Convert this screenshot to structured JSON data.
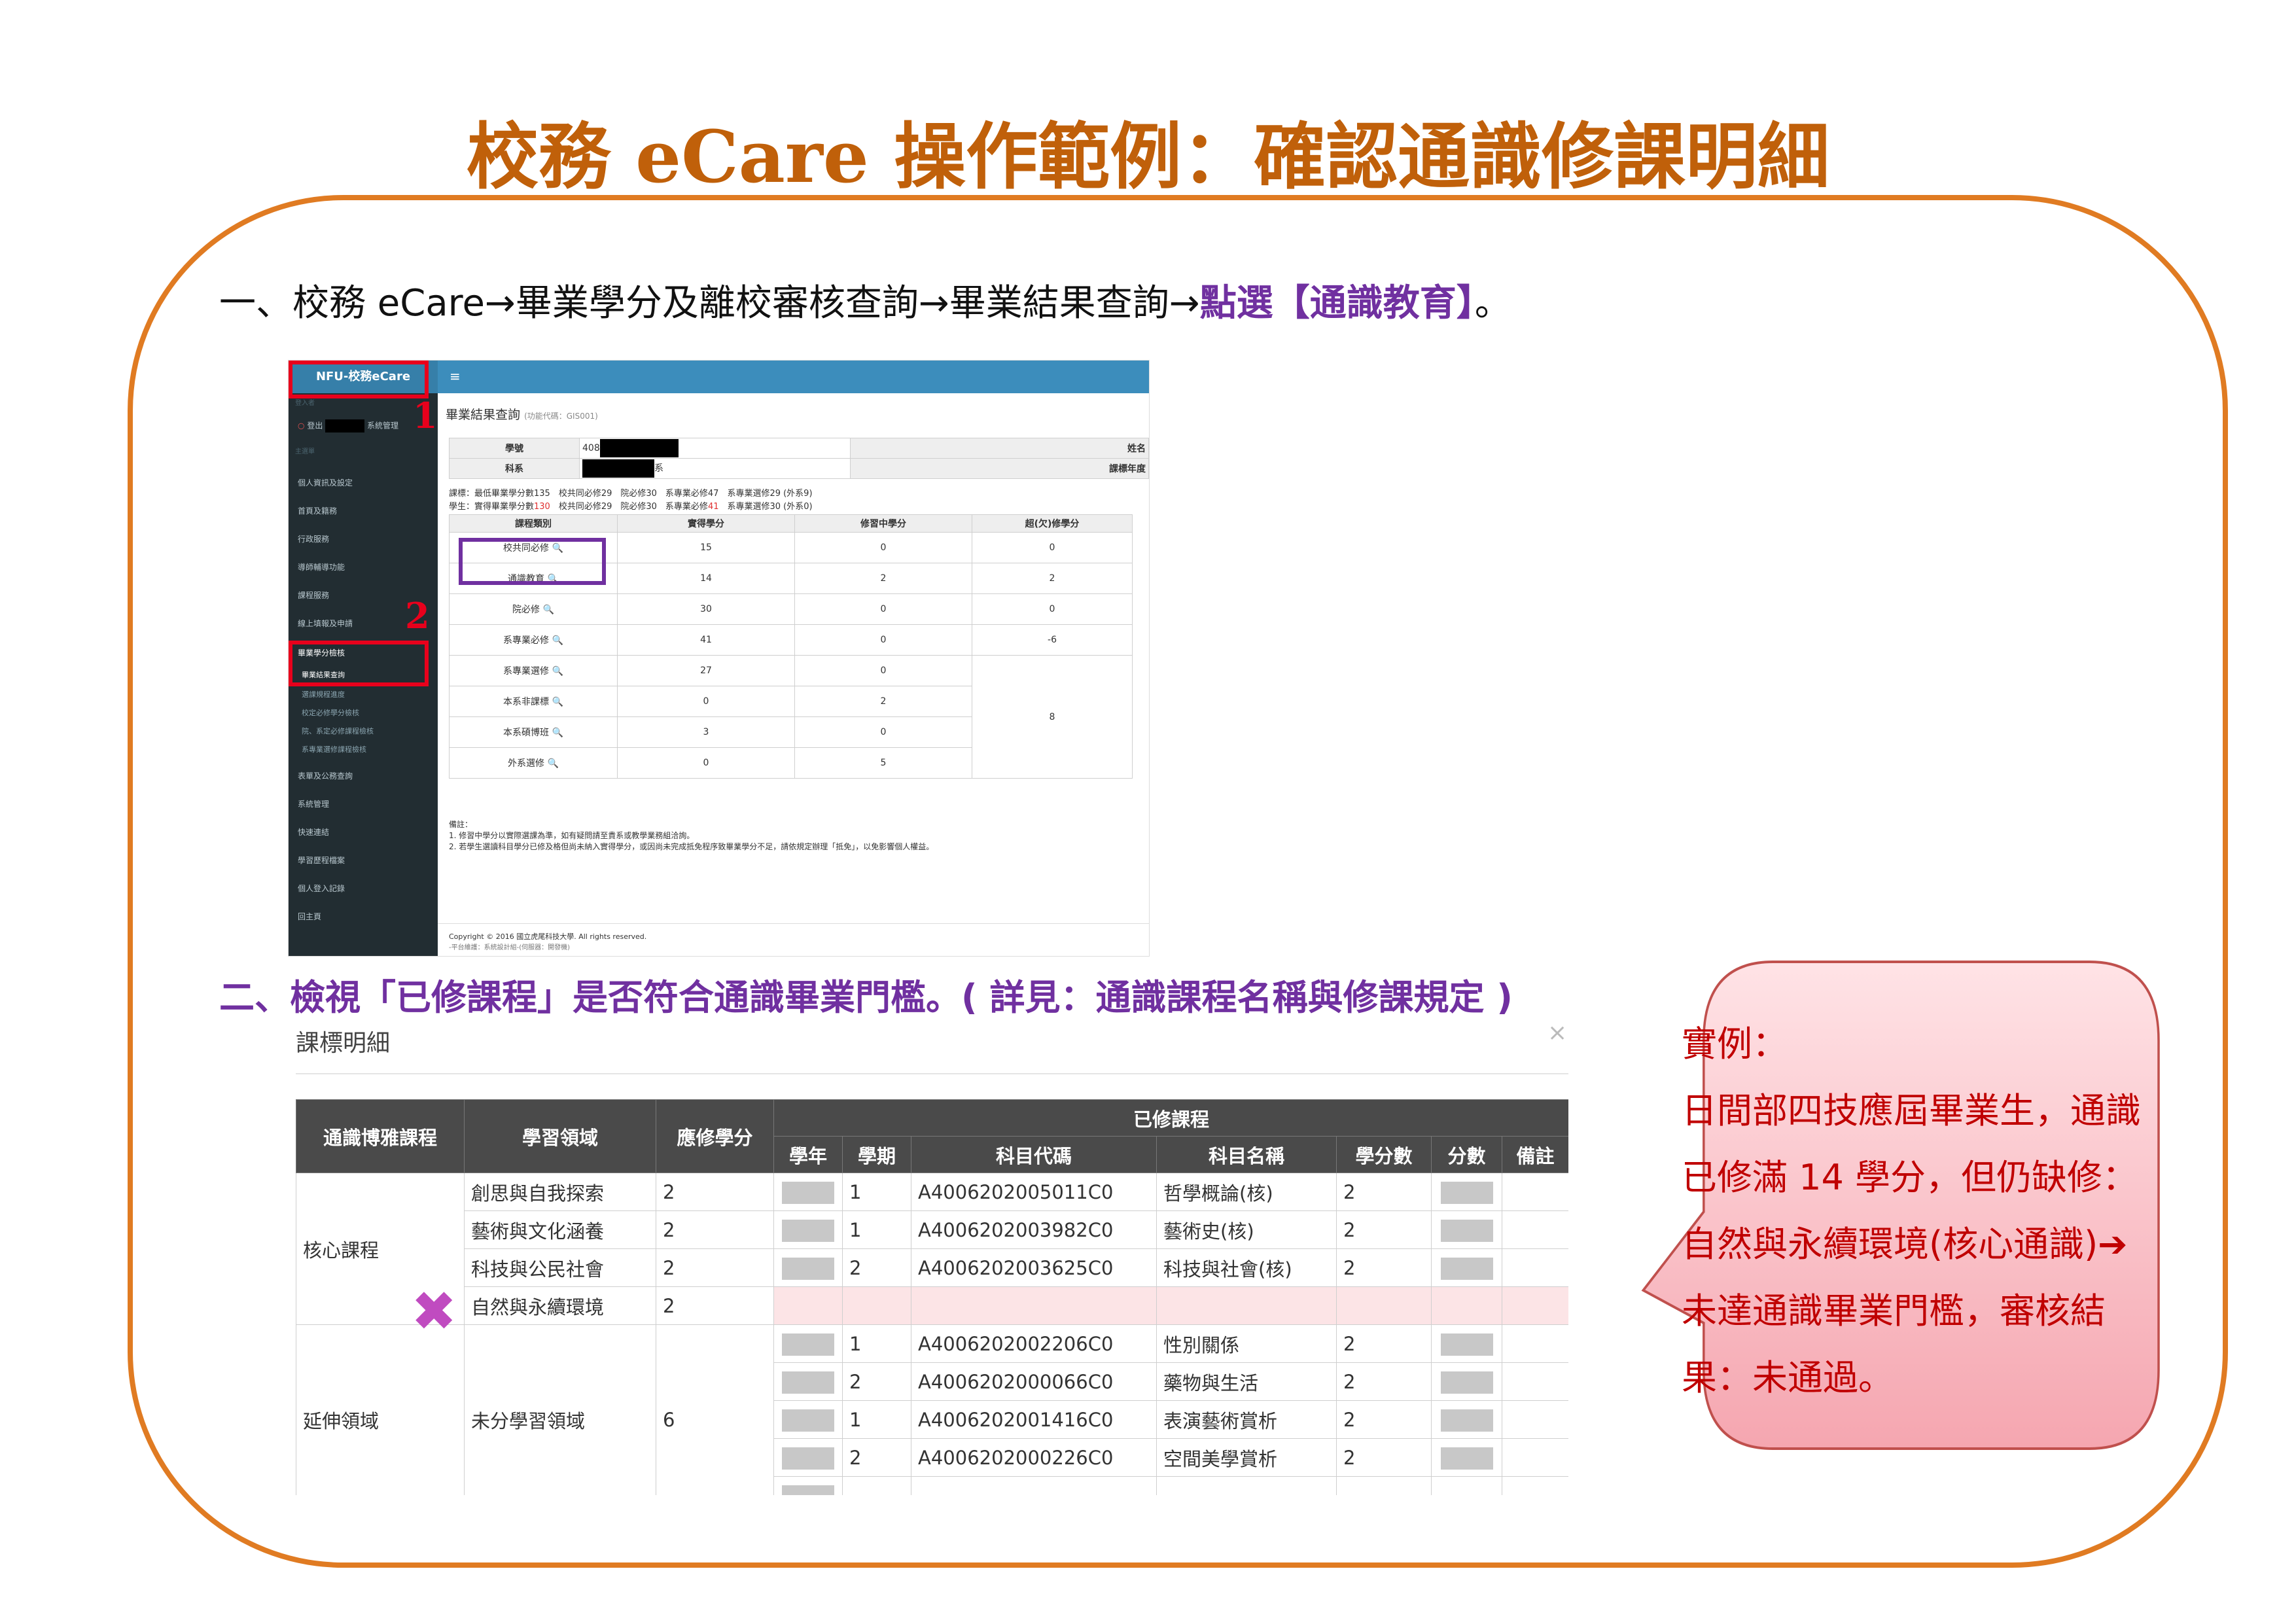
{
  "title": "校務 eCare 操作範例：確認通識修課明細",
  "step1": {
    "text": "一、校務 eCare→畢業學分及離校審核查詢→畢業結果查詢→",
    "highlight": "點選【通識教育】",
    "end": "。"
  },
  "step2": {
    "text": "二、檢視「已修課程」是否符合通識畢業門檻。( 詳見：通識課程名稱與修課規定 )"
  },
  "screenshot1": {
    "brand": "NFU-校務eCare",
    "hamburger": "≡",
    "sidebar_top_label": "登入者",
    "logout": "登出",
    "system": "系統管理",
    "menu_label": "主選單",
    "menu": [
      "個人資訊及設定",
      "首頁及籍務",
      "行政服務",
      "導師輔導功能",
      "課程服務",
      "線上填報及申請",
      "畢業學分檢核",
      "畢業結果查詢",
      "選課規程進度",
      "校定必修學分檢核",
      "院、系定必修課程檢核",
      "系專業選修課程檢核",
      "表單及公務查詢",
      "系統管理",
      "快速連結",
      "學習歷程檔案",
      "個人登入記錄",
      "回主頁"
    ],
    "markers": [
      "1",
      "2"
    ],
    "page_heading": "畢業結果查詢",
    "page_code": "(功能代碼：GIS001)",
    "info": {
      "student_id_label": "學號",
      "student_id": "408",
      "name_label": "姓名",
      "dept_label": "科系",
      "dept_suffix": "系",
      "year_label": "課標年度"
    },
    "rule1": "課標：最低畢業學分數135　校共同必修29　院必修30　系專業必修47　系專業選修29 (外系9)",
    "rule2a": "學生：實得畢業學分數",
    "rule2_value": "130",
    "rule2b": "　校共同必修29　院必修30　系專業必修",
    "rule2_value2": "41",
    "rule2c": "　系專業選修30 (外系0)",
    "table_headers": [
      "課程類別",
      "實得學分",
      "修習中學分",
      "超(欠)修學分"
    ],
    "rows": [
      {
        "name": "校共同必修",
        "earned": "15",
        "inprog": "0",
        "diff": "0"
      },
      {
        "name": "通識教育",
        "earned": "14",
        "inprog": "2",
        "diff": "2"
      },
      {
        "name": "院必修",
        "earned": "30",
        "inprog": "0",
        "diff": "0"
      },
      {
        "name": "系專業必修",
        "earned": "41",
        "inprog": "0",
        "diff": "-6"
      },
      {
        "name": "系專業選修",
        "earned": "27",
        "inprog": "0",
        "diff": ""
      },
      {
        "name": "本系非課標",
        "earned": "0",
        "inprog": "2",
        "diff": "8"
      },
      {
        "name": "本系碩博班",
        "earned": "3",
        "inprog": "0",
        "diff": ""
      },
      {
        "name": "外系選修",
        "earned": "0",
        "inprog": "5",
        "diff": ""
      }
    ],
    "search_icon": "🔍",
    "notes_title": "備註：",
    "note1": "1. 修習中學分以實際選課為準，如有疑問請至貴系或教學業務組洽詢。",
    "note2": "2. 若學生選讀科目學分已修及格但尚未納入實得學分，或因尚未完成抵免程序致畢業學分不足，請依規定辦理「抵免」，以免影響個人權益。",
    "copyright": "Copyright © 2016 國立虎尾科技大學. All rights reserved.",
    "footer": "-平台維護：系統設計組-(伺服器：開發機)"
  },
  "modal": {
    "title": "課標明細",
    "close": "×",
    "headers": {
      "col1": "通識博雅課程",
      "col2": "學習領域",
      "col3": "應修學分",
      "group": "已修課程",
      "sub": [
        "學年",
        "學期",
        "科目代碼",
        "科目名稱",
        "學分數",
        "分數",
        "備註"
      ]
    },
    "core_label": "核心課程",
    "ext_label": "延伸領域",
    "ext_area": "未分學習領域",
    "ext_credits": "6",
    "core_rows": [
      {
        "area": "創思與自我探索",
        "credits": "2",
        "term": "1",
        "code": "A4006202005011C0",
        "course": "哲學概論(核)",
        "cr": "2"
      },
      {
        "area": "藝術與文化涵養",
        "credits": "2",
        "term": "1",
        "code": "A4006202003982C0",
        "course": "藝術史(核)",
        "cr": "2"
      },
      {
        "area": "科技與公民社會",
        "credits": "2",
        "term": "2",
        "code": "A4006202003625C0",
        "course": "科技與社會(核)",
        "cr": "2"
      },
      {
        "area": "自然與永續環境",
        "credits": "2",
        "term": "",
        "code": "",
        "course": "",
        "cr": ""
      }
    ],
    "ext_rows": [
      {
        "term": "1",
        "code": "A4006202002206C0",
        "course": "性別關係",
        "cr": "2"
      },
      {
        "term": "2",
        "code": "A4006202000066C0",
        "course": "藥物與生活",
        "cr": "2"
      },
      {
        "term": "1",
        "code": "A4006202001416C0",
        "course": "表演藝術賞析",
        "cr": "2"
      },
      {
        "term": "2",
        "code": "A4006202000226C0",
        "course": "空間美學賞析",
        "cr": "2"
      }
    ],
    "x_mark": "✖"
  },
  "callout": {
    "line1": "實例：",
    "line2": "日間部四技應屆畢業生，通識已修滿 14 學分，但仍缺修：自然與永續環境(核心通識)",
    "arrow": "➔",
    "line3": "未達通識畢業門檻，審核結果：未通過。"
  }
}
